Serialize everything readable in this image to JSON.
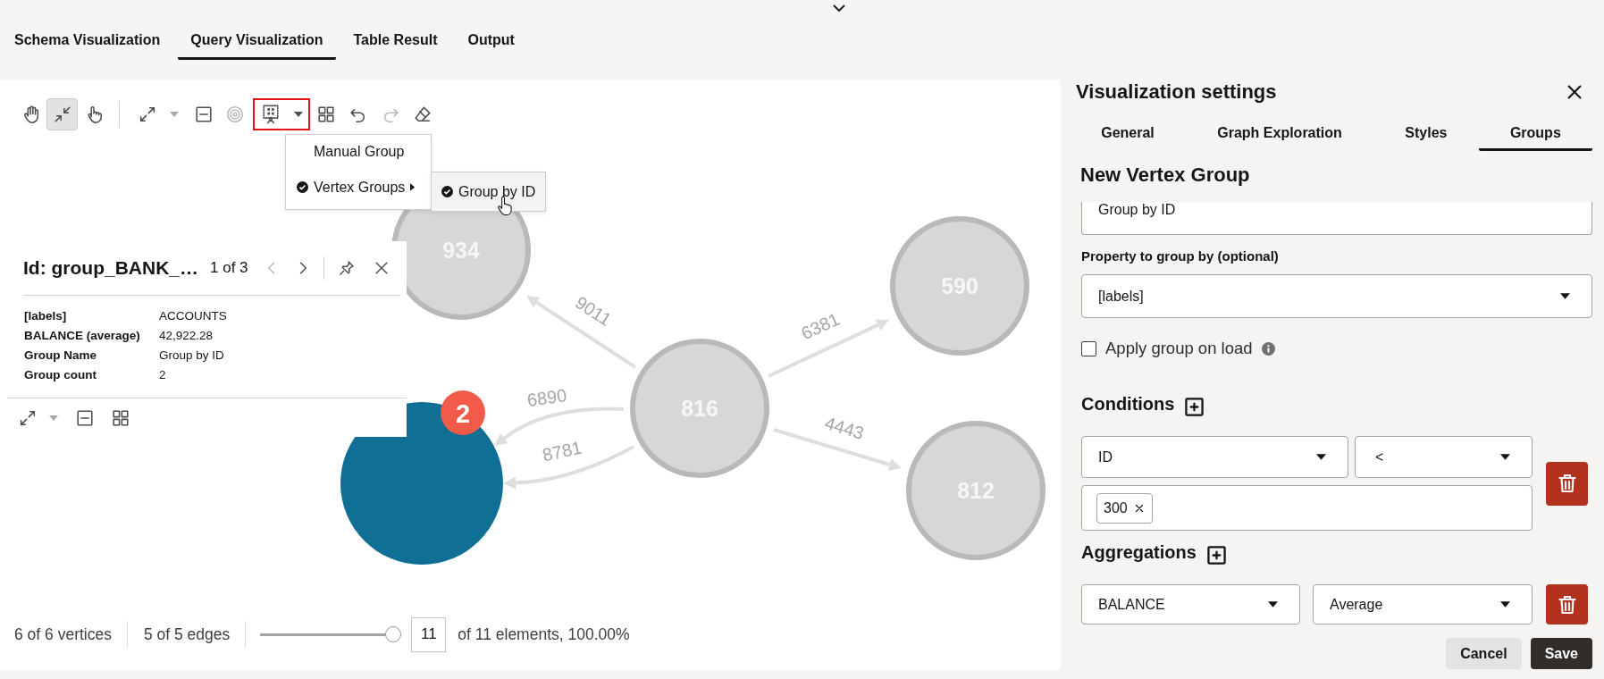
{
  "top_tabs": [
    {
      "label": "Schema Visualization",
      "selected": false
    },
    {
      "label": "Query Visualization",
      "selected": true
    },
    {
      "label": "Table Result",
      "selected": false
    },
    {
      "label": "Output",
      "selected": false
    }
  ],
  "canvas": {
    "toolbar": {
      "modes": [
        {
          "selected": false
        },
        {
          "selected": true
        },
        {
          "selected": false
        }
      ],
      "actions": [
        {
          "disabled": false,
          "highlighted": false
        },
        {
          "disabled": false,
          "highlighted": false
        },
        {
          "disabled": true,
          "highlighted": false
        },
        {
          "disabled": false,
          "highlighted": true
        },
        {
          "disabled": false,
          "highlighted": false
        },
        {
          "disabled": false,
          "highlighted": false
        },
        {
          "disabled": true,
          "highlighted": false
        },
        {
          "disabled": false,
          "highlighted": false
        }
      ]
    },
    "group_menu": {
      "items": [
        {
          "label": "Manual Group",
          "checked": false,
          "has_submenu": false
        },
        {
          "label": "Vertex Groups",
          "checked": true,
          "has_submenu": true
        }
      ],
      "submenu": [
        {
          "label": "Group by ID",
          "checked": true,
          "highlighted": true
        }
      ]
    },
    "info_panel": {
      "title": "Id: group_BANK_…",
      "pager": "1 of 3",
      "previous": {
        "disabled": true
      },
      "next": {
        "disabled": false
      },
      "properties": [
        {
          "name": "[labels]",
          "value": "ACCOUNTS"
        },
        {
          "name": "BALANCE (average)",
          "value": "42,922.28"
        },
        {
          "name": "Group Name",
          "value": "Group by ID"
        },
        {
          "name": "Group count",
          "value": "2"
        }
      ]
    },
    "graph": {
      "nodes": [
        {
          "kind": "vertex",
          "label": "934"
        },
        {
          "kind": "vertex",
          "label": "590"
        },
        {
          "kind": "vertex",
          "label": "816"
        },
        {
          "kind": "vertex",
          "label": "812"
        },
        {
          "kind": "group",
          "count": "2"
        }
      ],
      "edges": [
        {
          "label": "9011"
        },
        {
          "label": "6381"
        },
        {
          "label": "4443"
        },
        {
          "label": "6890"
        },
        {
          "label": "8781"
        }
      ]
    },
    "status_bar": {
      "vertices": "6 of 6 vertices",
      "edges": "5 of 5 edges",
      "slider": {
        "level": 1
      },
      "count_field": {
        "value": "11"
      },
      "elements": "of 11 elements, 100.00%"
    }
  },
  "settings": {
    "title": "Visualization settings",
    "tabs": [
      {
        "label": "General",
        "selected": false
      },
      {
        "label": "Graph Exploration",
        "selected": false
      },
      {
        "label": "Styles",
        "selected": false
      },
      {
        "label": "Groups",
        "selected": true
      }
    ],
    "heading": "New Vertex Group",
    "name_field": {
      "value": "Group by ID"
    },
    "property_label": "Property to group by (optional)",
    "property_select": {
      "value": "[labels]"
    },
    "apply_on_load": {
      "label": "Apply group on load",
      "checked": false
    },
    "conditions": {
      "title": "Conditions",
      "rows": [
        {
          "property": "ID",
          "operator": "<",
          "values": [
            "300"
          ]
        }
      ]
    },
    "aggregations": {
      "title": "Aggregations",
      "rows": [
        {
          "property": "BALANCE",
          "function": "Average"
        }
      ]
    },
    "buttons": [
      {
        "label": "Cancel",
        "kind": "secondary"
      },
      {
        "label": "Save",
        "kind": "primary"
      }
    ]
  }
}
